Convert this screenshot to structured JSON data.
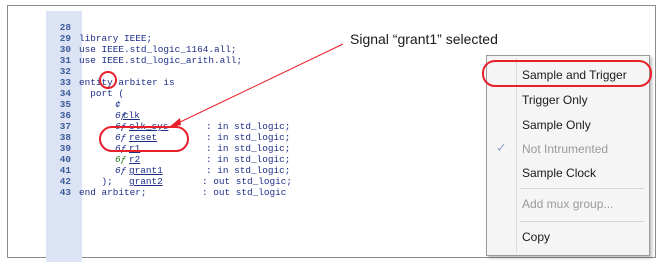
{
  "code": {
    "lines": [
      {
        "num": "28",
        "text": "library IEEE;"
      },
      {
        "num": "29",
        "text": "use IEEE.std_logic_1164.all;"
      },
      {
        "num": "30",
        "text": "use IEEE.std_logic_arith.all;"
      },
      {
        "num": "31",
        "text": ""
      },
      {
        "num": "32",
        "text": "entity arbiter is"
      },
      {
        "num": "33",
        "text": "  port ("
      },
      {
        "num": "34",
        "text": ": in std_logic;"
      },
      {
        "num": "35",
        "text": ": in std_logic;"
      },
      {
        "num": "36",
        "text": ": in std_logic;"
      },
      {
        "num": "37",
        "text": ": in std_logic;"
      },
      {
        "num": "38",
        "text": ": in std_logic;"
      },
      {
        "num": "39",
        "text": ": out std_logic;"
      },
      {
        "num": "40",
        "text": ": out std_logic"
      },
      {
        "num": "41",
        "text": "    );"
      },
      {
        "num": "42",
        "text": "end arbiter;"
      },
      {
        "num": "43",
        "text": ""
      }
    ],
    "signals": [
      {
        "name": "clk",
        "icon": "¢"
      },
      {
        "name": "clk_sys",
        "icon": "6ƒ"
      },
      {
        "name": "reset",
        "icon": "6ƒ"
      },
      {
        "name": "r1",
        "icon": "6ƒ"
      },
      {
        "name": "r2",
        "icon": "6ƒ"
      },
      {
        "name": "grant1",
        "icon": "6ƒ"
      },
      {
        "name": "grant2",
        "icon": "6ƒ"
      }
    ]
  },
  "annotation": {
    "label": "Signal “grant1” selected",
    "color": "#e8202a"
  },
  "context_menu": {
    "items": [
      {
        "label": "Sample and Trigger",
        "disabled": false,
        "highlighted": true
      },
      {
        "label": "Trigger Only",
        "disabled": false
      },
      {
        "label": "Sample Only",
        "disabled": false
      },
      {
        "label": "Not Intrumented",
        "disabled": true,
        "checked": true
      },
      {
        "label": "Sample Clock",
        "disabled": false
      },
      {
        "label": "Add mux group...",
        "disabled": true
      },
      {
        "label": "Copy",
        "disabled": false
      }
    ],
    "check_glyph": "✓"
  }
}
